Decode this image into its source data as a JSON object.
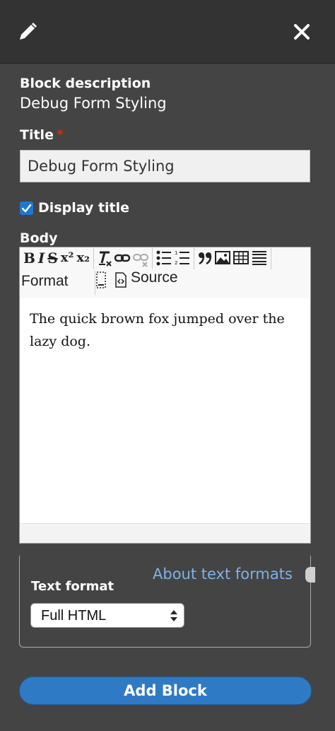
{
  "block_description": {
    "label": "Block description",
    "value": "Debug Form Styling"
  },
  "title_field": {
    "label": "Title",
    "required_marker": "*",
    "value": "Debug Form Styling"
  },
  "display_title": {
    "label": "Display title",
    "checked": true
  },
  "body": {
    "label": "Body",
    "toolbar": {
      "bold": "B",
      "italic": "I",
      "strike": "S",
      "superscript": "x²",
      "subscript": "x₂",
      "format_label": "Format",
      "source_label": "Source"
    },
    "content": "The quick brown fox jumped over the lazy dog."
  },
  "text_format": {
    "about_link": "About text formats",
    "label": "Text format",
    "selected": "Full HTML"
  },
  "submit": {
    "label": "Add Block"
  },
  "colors": {
    "background": "#444444",
    "topbar": "#333333",
    "accent": "#2f7ac4",
    "link": "#7db2e8",
    "required": "#e62600"
  }
}
